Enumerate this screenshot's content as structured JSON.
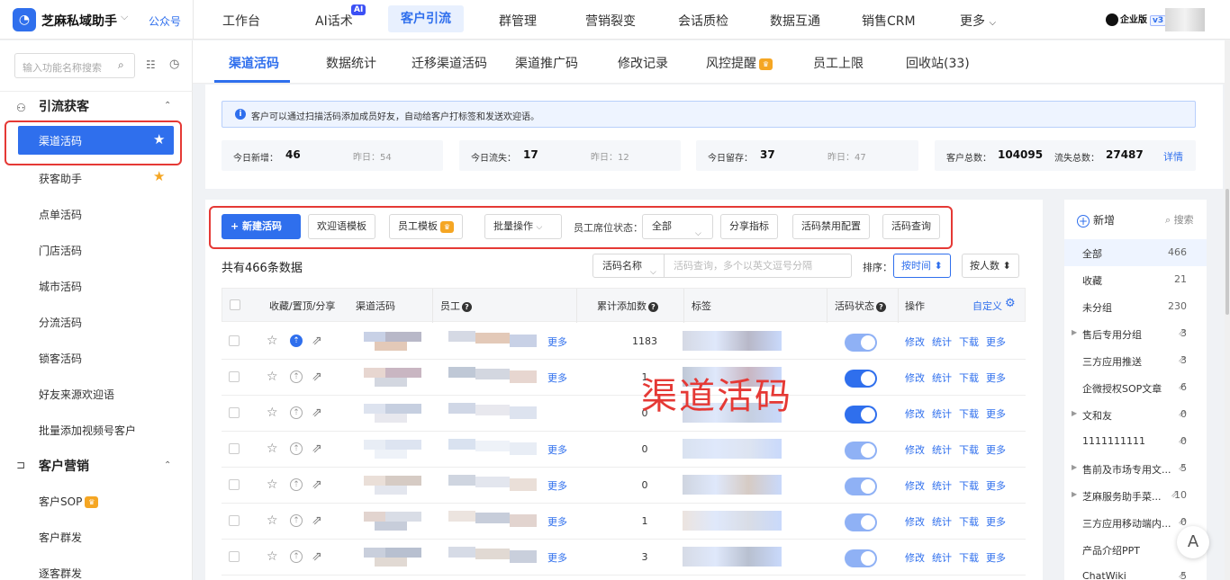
{
  "app": {
    "name": "芝麻私域助手",
    "account": "公众号"
  },
  "topnav": [
    "工作台",
    "AI话术",
    "客户引流",
    "群管理",
    "营销裂变",
    "会话质检",
    "数据互通",
    "销售CRM",
    "更多"
  ],
  "topnav_active": "客户引流",
  "ai_badge": "AI",
  "edition": {
    "label": "企业版",
    "version": "v3"
  },
  "sidebar": {
    "search_placeholder": "输入功能名称搜索",
    "groups": [
      {
        "title": "引流获客",
        "items": [
          "渠道活码",
          "获客助手",
          "点单活码",
          "门店活码",
          "城市活码",
          "分流活码",
          "锁客活码",
          "好友来源欢迎语",
          "批量添加视频号客户"
        ]
      },
      {
        "title": "客户营销",
        "items": [
          "客户SOP",
          "客户群发",
          "逐客群发"
        ]
      }
    ]
  },
  "subtabs": [
    "渠道活码",
    "数据统计",
    "迁移渠道活码",
    "渠道推广码",
    "修改记录",
    "风控提醒",
    "员工上限",
    "回收站(33)"
  ],
  "notice": "客户可以通过扫描活码添加成员好友，自动给客户打标签和发送欢迎语。",
  "stats": {
    "today_new_label": "今日新增：",
    "today_new": "46",
    "yday_new": "昨日：54",
    "today_lost_label": "今日流失：",
    "today_lost": "17",
    "yday_lost": "昨日：12",
    "today_keep_label": "今日留存：",
    "today_keep": "37",
    "yday_keep": "昨日：47",
    "total_label": "客户总数：",
    "total": "104095",
    "lost_total_label": "流失总数：",
    "lost_total": "27487",
    "detail": "详情"
  },
  "toolbar": {
    "new": "+ 新建活码",
    "welcome": "欢迎语模板",
    "staff_tpl": "员工模板",
    "batch": "批量操作",
    "seat_label": "员工席位状态：",
    "seat_value": "全部",
    "share": "分享指标",
    "disable_cfg": "活码禁用配置",
    "query": "活码查询"
  },
  "list": {
    "count": "共有466条数据",
    "filter_field": "活码名称",
    "filter_placeholder": "活码查询，多个以英文逗号分隔",
    "sort_label": "排序：",
    "sort_time": "按时间",
    "sort_people": "按人数"
  },
  "table": {
    "headers": {
      "fav": "收藏/置顶/分享",
      "name": "渠道活码",
      "staff": "员工",
      "added": "累计添加数",
      "tags": "标签",
      "status": "活码状态",
      "ops": "操作",
      "custom": "自定义"
    },
    "more": "更多",
    "ops": [
      "修改",
      "统计",
      "下载",
      "更多"
    ],
    "rows": [
      {
        "added": "1183",
        "pinned": true,
        "more": true,
        "on": false
      },
      {
        "added": "1",
        "pinned": false,
        "more": true,
        "on": true
      },
      {
        "added": "0",
        "pinned": false,
        "more": false,
        "on": true
      },
      {
        "added": "0",
        "pinned": false,
        "more": true,
        "on": false
      },
      {
        "added": "0",
        "pinned": false,
        "more": true,
        "on": false
      },
      {
        "added": "1",
        "pinned": false,
        "more": true,
        "on": false
      },
      {
        "added": "3",
        "pinned": false,
        "more": true,
        "on": false
      }
    ]
  },
  "watermark": "渠道活码",
  "groups_panel": {
    "add": "新增",
    "search": "搜索",
    "items": [
      {
        "label": "全部",
        "count": "466",
        "share": false,
        "tri": false
      },
      {
        "label": "收藏",
        "count": "21",
        "share": false,
        "tri": false
      },
      {
        "label": "未分组",
        "count": "230",
        "share": false,
        "tri": false
      },
      {
        "label": "售后专用分组",
        "count": "3",
        "share": true,
        "tri": true
      },
      {
        "label": "三方应用推送",
        "count": "3",
        "share": true,
        "tri": false
      },
      {
        "label": "企微授权SOP文章",
        "count": "6",
        "share": true,
        "tri": false
      },
      {
        "label": "文和友",
        "count": "0",
        "share": true,
        "tri": true
      },
      {
        "label": "1111111111",
        "count": "0",
        "share": true,
        "tri": false
      },
      {
        "label": "售前及市场专用文...",
        "count": "5",
        "share": true,
        "tri": true
      },
      {
        "label": "芝麻服务助手菜...",
        "count": "10",
        "share": true,
        "tri": true
      },
      {
        "label": "三方应用移动端内...",
        "count": "0",
        "share": true,
        "tri": false
      },
      {
        "label": "产品介绍PPT",
        "count": "",
        "share": false,
        "tri": false
      },
      {
        "label": "ChatWiki",
        "count": "5",
        "share": true,
        "tri": false
      }
    ]
  },
  "fab": "A"
}
